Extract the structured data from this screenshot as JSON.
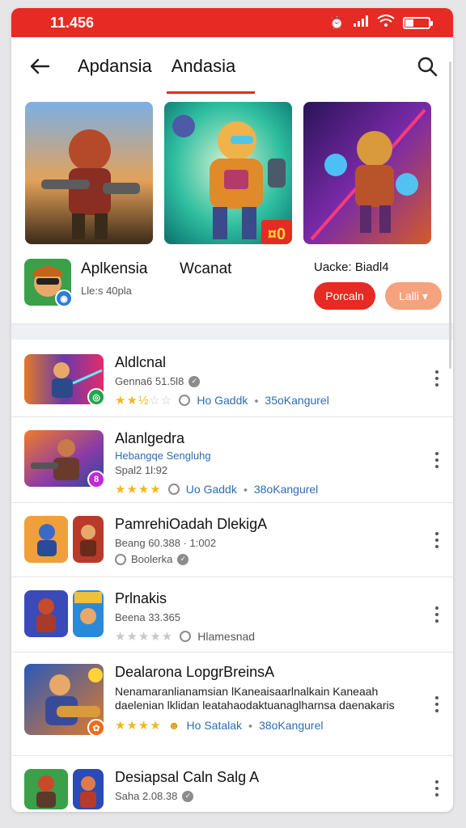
{
  "status": {
    "time": "11.456",
    "accent": "#e52b24"
  },
  "header": {
    "tabs": [
      "Apdansia",
      "Andasia"
    ],
    "active_tab": 1
  },
  "featured": {
    "app_title": "Aplkensia",
    "app_sub": "Lle:s 40pla",
    "col2_title": "Wcanat",
    "col3_title": "Uacke: Biadl4",
    "primary_btn": "Porcaln",
    "secondary_btn": "Lalli ▾",
    "thumb3_badge": "¤0"
  },
  "rows": [
    {
      "title": "Aldlcnal",
      "line1": "Genna6 51.5l8",
      "stars": 2.5,
      "meta1": "Ho Gaddk",
      "meta2": "35oKangurel"
    },
    {
      "title": "Alanlgedra",
      "line0": "Hebangqe Sengluhg",
      "line1": "Spal2 1l:92",
      "stars": 4,
      "meta1": "Uo Gaddk",
      "meta2": "38oKangurel"
    },
    {
      "title": "PamrehiOadah DlekigA",
      "line1": "Beang 60.388 · 1:002",
      "line2": "Boolerka"
    },
    {
      "title": "Prlnakis",
      "line1": "Beena 33.365",
      "stars": 0,
      "meta1": "Hlamesnad"
    },
    {
      "title": "Dealarona LopgrBreinsA",
      "desc": "Nenamaranlianamsian lKaneaisaarlnalkain Kaneaah daelenian lklidan leatahaodaktuanaglharnsa daenakaris",
      "stars": 4,
      "meta1": "Ho Satalak",
      "meta2": "38oKangurel"
    },
    {
      "title": "Desiapsal Caln Salg A",
      "line1": "Saha 2.08.38"
    }
  ]
}
